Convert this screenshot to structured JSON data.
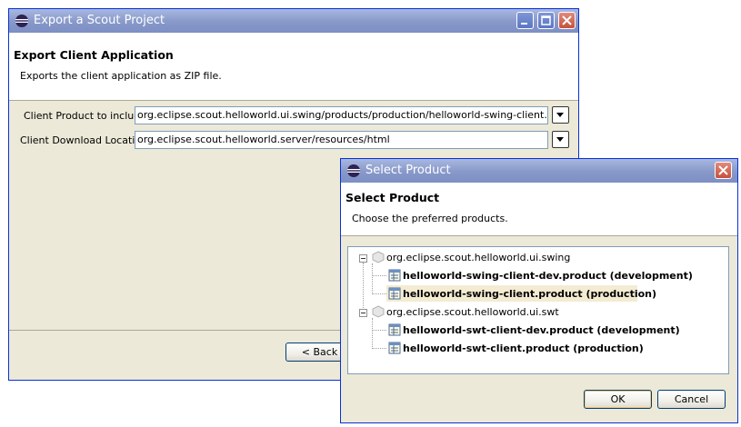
{
  "export_window": {
    "title": "Export a Scout Project",
    "heading": "Export Client Application",
    "description": "Exports the client application as ZIP file.",
    "product_label": "Client Product to include",
    "product_value": "org.eclipse.scout.helloworld.ui.swing/products/production/helloworld-swing-client.product",
    "location_label": "Client Download Location",
    "location_value": "org.eclipse.scout.helloworld.server/resources/html",
    "back_label": "< Back"
  },
  "select_dialog": {
    "title": "Select Product",
    "heading": "Select Product",
    "description": "Choose the preferred products.",
    "tree": [
      {
        "label": "org.eclipse.scout.helloworld.ui.swing",
        "children": [
          {
            "label": "helloworld-swing-client-dev.product (development)",
            "selected": false
          },
          {
            "label": "helloworld-swing-client.product (production)",
            "selected": true
          }
        ]
      },
      {
        "label": "org.eclipse.scout.helloworld.ui.swt",
        "children": [
          {
            "label": "helloworld-swt-client-dev.product (development)",
            "selected": false
          },
          {
            "label": "helloworld-swt-client.product (production)",
            "selected": false
          }
        ]
      }
    ],
    "ok_label": "OK",
    "cancel_label": "Cancel"
  },
  "colors": {
    "title_bar": "#8798c9",
    "selection": "#f3ecd2",
    "dialog_bg": "#ece9d8"
  },
  "icons": {
    "window": "eclipse-icon",
    "product": "product-file-icon",
    "plugin": "plugin-icon"
  }
}
